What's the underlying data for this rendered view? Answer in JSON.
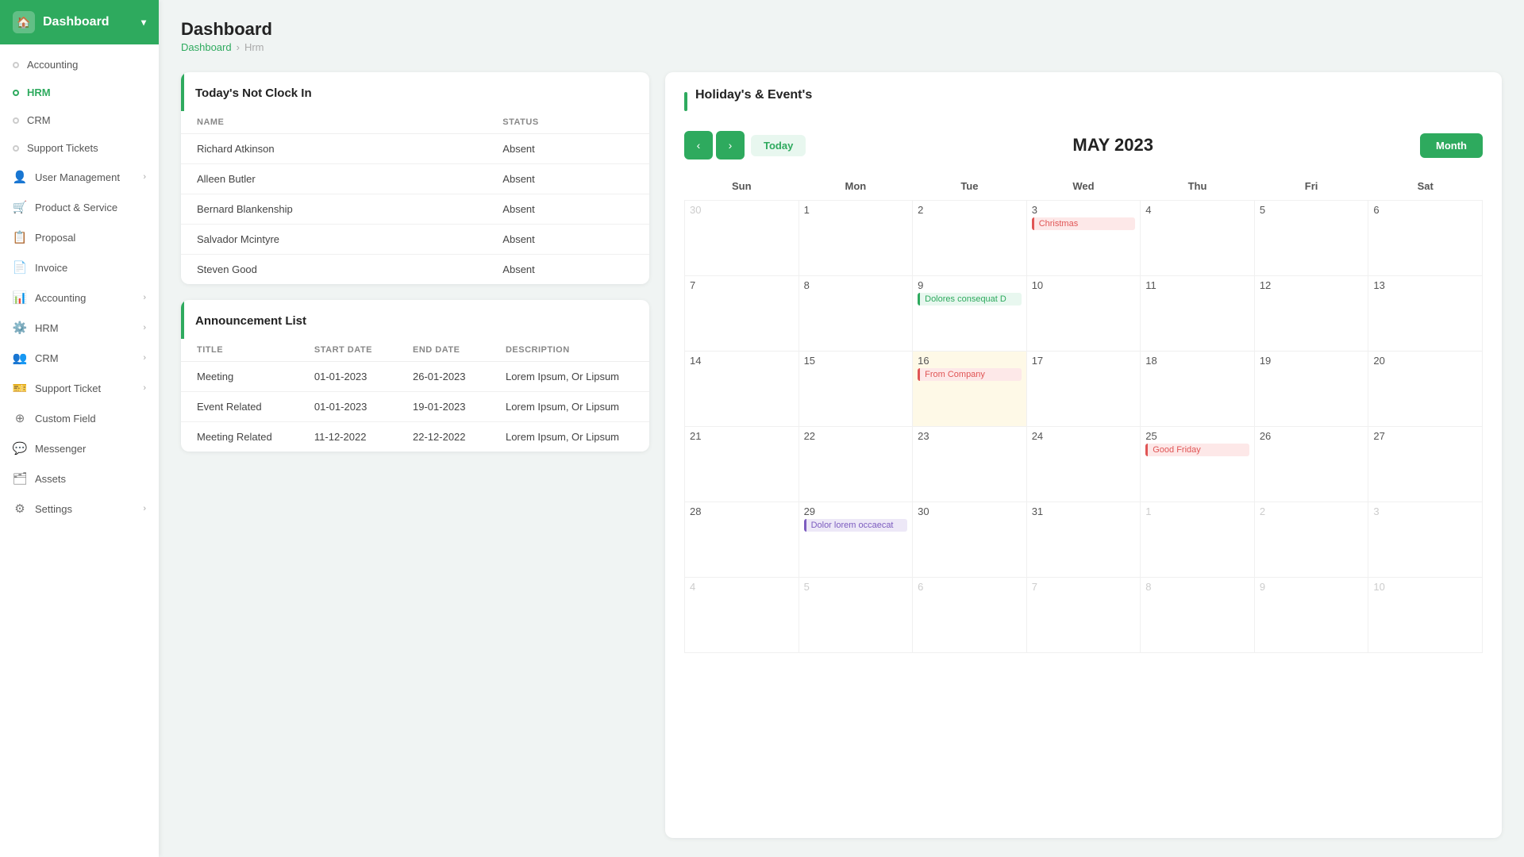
{
  "sidebar": {
    "header": {
      "label": "Dashboard",
      "icon": "🏠"
    },
    "items": [
      {
        "id": "accounting-top",
        "label": "Accounting",
        "type": "dot",
        "active": false
      },
      {
        "id": "hrm-top",
        "label": "HRM",
        "type": "dot",
        "active": true
      },
      {
        "id": "crm-top",
        "label": "CRM",
        "type": "dot",
        "active": false
      },
      {
        "id": "support-tickets-top",
        "label": "Support Tickets",
        "type": "dot",
        "active": false
      },
      {
        "id": "user-management",
        "label": "User Management",
        "type": "icon",
        "icon": "👤",
        "hasArrow": true
      },
      {
        "id": "product-service",
        "label": "Product & Service",
        "type": "icon",
        "icon": "🛒",
        "hasArrow": false
      },
      {
        "id": "proposal",
        "label": "Proposal",
        "type": "icon",
        "icon": "📋",
        "hasArrow": false
      },
      {
        "id": "invoice",
        "label": "Invoice",
        "type": "icon",
        "icon": "📄",
        "hasArrow": false
      },
      {
        "id": "accounting",
        "label": "Accounting",
        "type": "icon",
        "icon": "📊",
        "hasArrow": true
      },
      {
        "id": "hrm",
        "label": "HRM",
        "type": "icon",
        "icon": "⚙",
        "hasArrow": true
      },
      {
        "id": "crm",
        "label": "CRM",
        "type": "icon",
        "icon": "👥",
        "hasArrow": true
      },
      {
        "id": "support-ticket",
        "label": "Support Ticket",
        "type": "icon",
        "icon": "🎫",
        "hasArrow": true
      },
      {
        "id": "custom-field",
        "label": "Custom Field",
        "type": "icon",
        "icon": "⊕",
        "hasArrow": false
      },
      {
        "id": "messenger",
        "label": "Messenger",
        "type": "icon",
        "icon": "💬",
        "hasArrow": false
      },
      {
        "id": "assets",
        "label": "Assets",
        "type": "icon",
        "icon": "🗂",
        "hasArrow": false
      },
      {
        "id": "settings",
        "label": "Settings",
        "type": "icon",
        "icon": "⚙",
        "hasArrow": true
      }
    ]
  },
  "page": {
    "title": "Dashboard",
    "breadcrumb": [
      "Dashboard",
      "Hrm"
    ]
  },
  "clock_in_section": {
    "title": "Today's Not Clock In",
    "columns": [
      "NAME",
      "STATUS"
    ],
    "rows": [
      {
        "name": "Richard Atkinson",
        "status": "Absent"
      },
      {
        "name": "Alleen Butler",
        "status": "Absent"
      },
      {
        "name": "Bernard Blankenship",
        "status": "Absent"
      },
      {
        "name": "Salvador Mcintyre",
        "status": "Absent"
      },
      {
        "name": "Steven Good",
        "status": "Absent"
      }
    ]
  },
  "announcement_section": {
    "title": "Announcement List",
    "columns": [
      "TITLE",
      "START DATE",
      "END DATE",
      "DESCRIPTION"
    ],
    "rows": [
      {
        "title": "Meeting",
        "start": "01-01-2023",
        "end": "26-01-2023",
        "desc": "Lorem Ipsum, Or Lipsum"
      },
      {
        "title": "Event Related",
        "start": "01-01-2023",
        "end": "19-01-2023",
        "desc": "Lorem Ipsum, Or Lipsum"
      },
      {
        "title": "Meeting Related",
        "start": "11-12-2022",
        "end": "22-12-2022",
        "desc": "Lorem Ipsum, Or Lipsum"
      }
    ]
  },
  "calendar": {
    "section_title": "Holiday's & Event's",
    "month_label": "MAY 2023",
    "today_btn": "Today",
    "month_btn": "Month",
    "days": [
      "Sun",
      "Mon",
      "Tue",
      "Wed",
      "Thu",
      "Fri",
      "Sat"
    ],
    "events": {
      "3": {
        "label": "Christmas",
        "type": "red"
      },
      "9": {
        "label": "Dolores consequat D",
        "type": "green"
      },
      "16": {
        "label": "From Company",
        "type": "red"
      },
      "25": {
        "label": "Good Friday",
        "type": "red"
      },
      "29": {
        "label": "Dolor lorem occaecat",
        "type": "purple"
      }
    },
    "highlighted": {
      "16": "yellow"
    }
  }
}
